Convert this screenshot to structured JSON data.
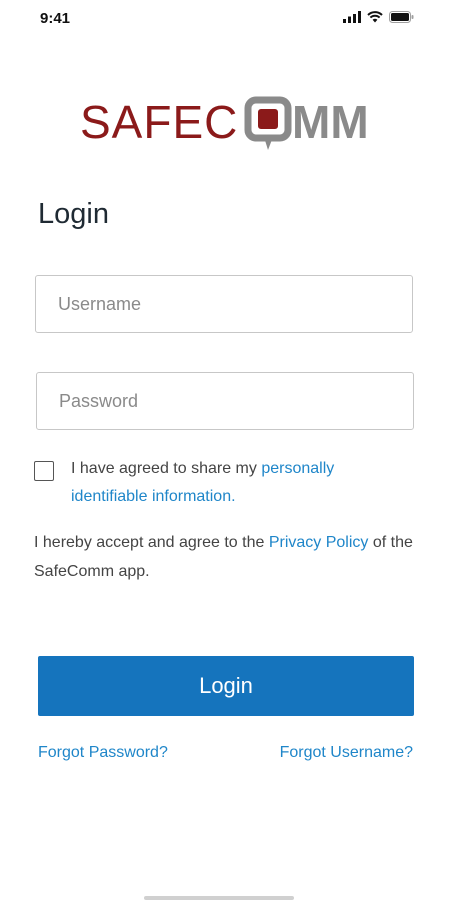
{
  "status_bar": {
    "time": "9:41",
    "icons": [
      "cellular-signal-icon",
      "wifi-icon",
      "battery-icon"
    ]
  },
  "logo": {
    "text_part1": "SAFEC",
    "text_part2": "MM",
    "colors": {
      "safe": "#8b1a1a",
      "comm": "#8a8a8a",
      "bubble": "#8b1a1a"
    }
  },
  "page_title": "Login",
  "form": {
    "username_placeholder": "Username",
    "password_placeholder": "Password"
  },
  "consent": {
    "checked": false,
    "text_before": "I have agreed to share my ",
    "link_text": "personally identifiable information."
  },
  "privacy": {
    "text_before": "I hereby accept and agree to the ",
    "link_text": "Privacy Policy",
    "text_after": " of the SafeComm app."
  },
  "login_button": "Login",
  "forgot_password": "Forgot Password?",
  "forgot_username": "Forgot Username?",
  "colors": {
    "accent": "#1574bd",
    "link": "#1f86c9"
  }
}
